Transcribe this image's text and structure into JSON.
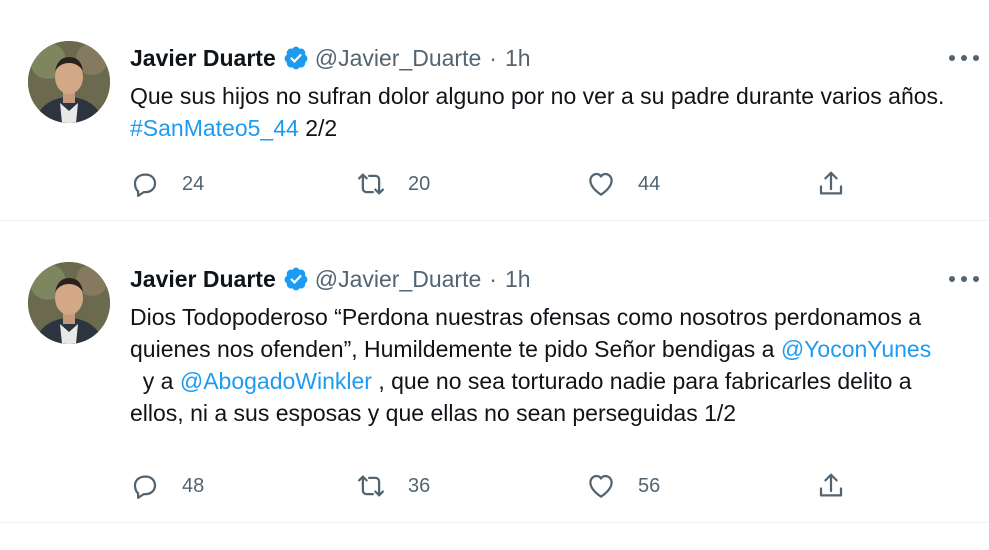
{
  "tweets": [
    {
      "author": "Javier Duarte",
      "handle": "@Javier_Duarte",
      "separator": "·",
      "time": "1h",
      "text_parts": [
        "Que sus hijos no sufran dolor alguno por no ver a su padre durante varios años. ",
        "#SanMateo5_44",
        " 2/2"
      ],
      "replies": "24",
      "retweets": "20",
      "likes": "44"
    },
    {
      "author": "Javier Duarte",
      "handle": "@Javier_Duarte",
      "separator": "·",
      "time": "1h",
      "text_parts": [
        "Dios Todopoderoso “Perdona nuestras ofensas como nosotros perdonamos a quienes nos ofenden”, Humildemente te pido Señor bendigas a ",
        "@YoconYunes",
        "  y a ",
        "@AbogadoWinkler",
        " , que no sea torturado nadie para fabricarles delito a ellos, ni a sus esposas y que ellas no sean perseguidas 1/2"
      ],
      "replies": "48",
      "retweets": "36",
      "likes": "56"
    }
  ],
  "icons": {
    "verified": "verified-badge-icon",
    "more": "more-options-icon",
    "reply": "reply-icon",
    "retweet": "retweet-icon",
    "like": "heart-icon",
    "share": "share-icon"
  },
  "colors": {
    "link": "#1d9bf0",
    "secondary_text": "#536471",
    "verified": "#1d9bf0",
    "divider": "#eff3f4"
  }
}
